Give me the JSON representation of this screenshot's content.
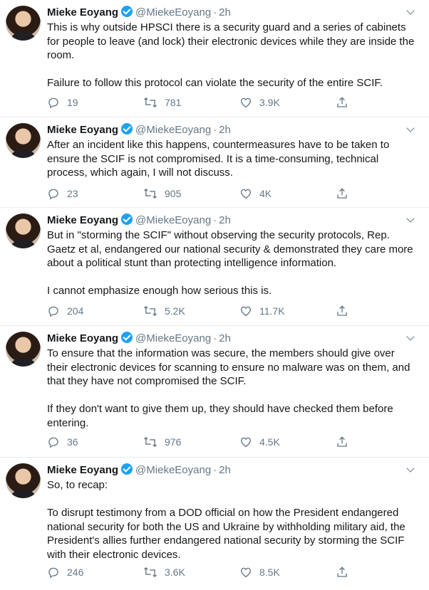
{
  "tweets": [
    {
      "name": "Mieke Eoyang",
      "handle": "@MiekeEoyang",
      "time": "2h",
      "paragraphs": [
        "This is why outside HPSCI there is a security guard and a series of cabinets for people to leave (and lock) their electronic devices while they are inside the room.",
        "Failure to follow this protocol can violate the security of the entire SCIF."
      ],
      "replies": "19",
      "retweets": "781",
      "likes": "3.9K"
    },
    {
      "name": "Mieke Eoyang",
      "handle": "@MiekeEoyang",
      "time": "2h",
      "paragraphs": [
        "After an incident like this happens, countermeasures have to be taken to ensure the SCIF is not compromised. It is a time-consuming, technical process, which again, I will not discuss."
      ],
      "replies": "23",
      "retweets": "905",
      "likes": "4K"
    },
    {
      "name": "Mieke Eoyang",
      "handle": "@MiekeEoyang",
      "time": "2h",
      "paragraphs": [
        "But in \"storming the SCIF\" without observing the security protocols, Rep. Gaetz et al,  endangered our national security & demonstrated they care more about a political stunt than protecting intelligence information.",
        "I cannot emphasize enough how serious this is."
      ],
      "replies": "204",
      "retweets": "5.2K",
      "likes": "11.7K"
    },
    {
      "name": "Mieke Eoyang",
      "handle": "@MiekeEoyang",
      "time": "2h",
      "paragraphs": [
        "To ensure that the information was secure, the members should give over their electronic devices for scanning to ensure no malware was on them, and that they have not compromised the SCIF.",
        "If they don't want to give them up, they should have checked them before entering."
      ],
      "replies": "36",
      "retweets": "976",
      "likes": "4.5K"
    },
    {
      "name": "Mieke Eoyang",
      "handle": "@MiekeEoyang",
      "time": "2h",
      "paragraphs": [
        "So, to recap:",
        "To disrupt testimony from a DOD official on how the President endangered national security for both the US and Ukraine by withholding military aid, the President's allies further endangered national security by storming the SCIF with their electronic devices."
      ],
      "replies": "246",
      "retweets": "3.6K",
      "likes": "8.5K"
    }
  ],
  "colors": {
    "text": "#14171a",
    "muted": "#657786",
    "verified": "#1da1f2",
    "divider": "#e6ecf0"
  }
}
